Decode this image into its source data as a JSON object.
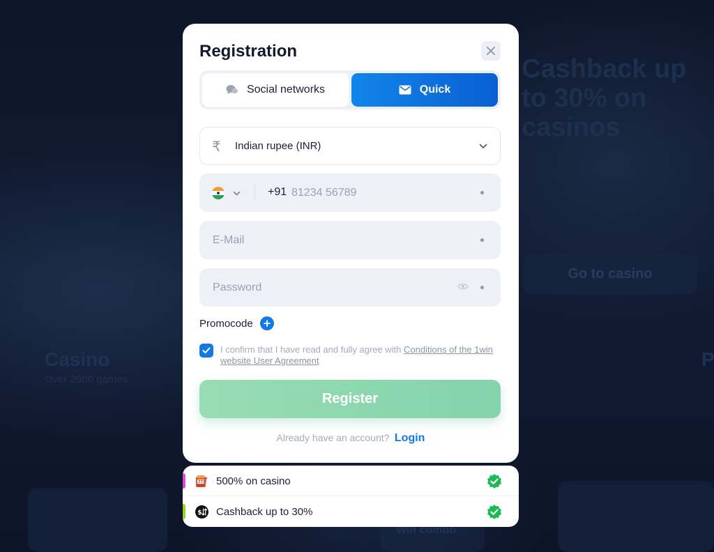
{
  "colors": {
    "primary_blue": "#1279e6",
    "register_green": "#8fd8b0",
    "success_green": "#1db954",
    "accent_pink": "#d64fd3",
    "accent_lime": "#9ad21f"
  },
  "background": {
    "hero_text": "Cashback up to 30% on casinos",
    "go_button": "Go to casino",
    "casino_title": "Casino",
    "casino_subtitle": "Over 2000 games",
    "right_letter": "P",
    "bottom_text": "Win combo"
  },
  "modal": {
    "title": "Registration",
    "close_icon": "close-icon",
    "tabs": [
      {
        "label": "Social networks",
        "icon": "chat-bubble-icon",
        "active": false
      },
      {
        "label": "Quick",
        "icon": "envelope-icon",
        "active": true
      }
    ],
    "currency": {
      "icon": "rupee-icon",
      "symbol": "₹",
      "selected": "Indian rupee (INR)"
    },
    "phone": {
      "country_icon": "india-flag-icon",
      "code": "+91",
      "placeholder": "81234 56789"
    },
    "email": {
      "placeholder": "E-Mail"
    },
    "password": {
      "placeholder": "Password",
      "icon": "eye-icon"
    },
    "promocode": {
      "label": "Promocode",
      "icon": "plus-icon"
    },
    "agreement": {
      "checked": true,
      "text": "I confirm that I have read and fully agree with",
      "link": "Conditions of the 1win website User Agreement"
    },
    "register_label": "Register",
    "login_prompt": "Already have an account?",
    "login_link": "Login"
  },
  "bonuses": [
    {
      "label": "500% on casino",
      "icon": "slot-machine-icon",
      "status_icon": "check-badge-icon"
    },
    {
      "label": "Cashback up to 30%",
      "icon": "cashback-icon",
      "status_icon": "check-badge-icon"
    }
  ]
}
